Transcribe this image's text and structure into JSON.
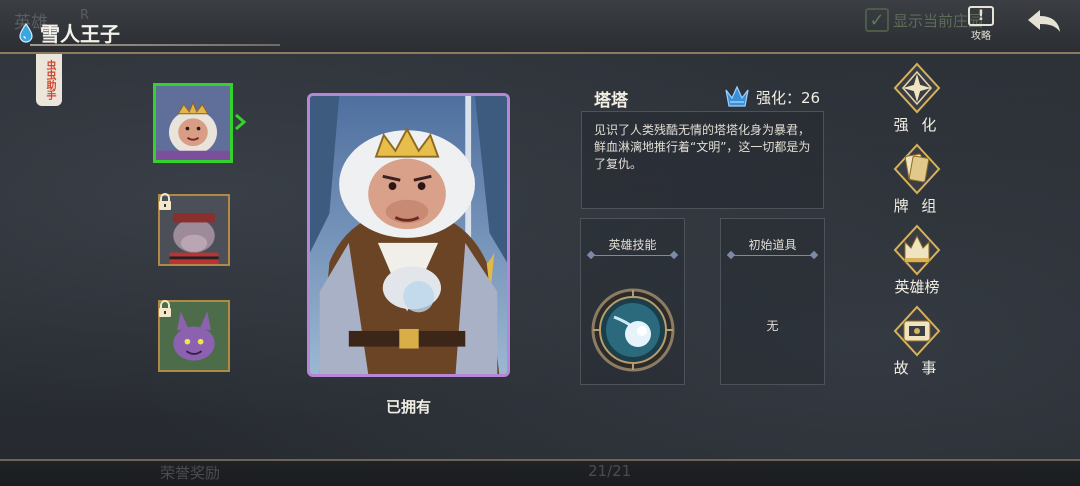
{
  "header": {
    "faded_tab_1": "英雄",
    "faded_tab_2": "R",
    "title": "雪人王子",
    "show_current_label": "显示当前庄园",
    "guide_label": "攻略"
  },
  "helper_tab": "虫虫助手",
  "hero_list": [
    {
      "name": "snowman-prince",
      "locked": false,
      "selected": true
    },
    {
      "name": "hippo-pirate",
      "locked": true,
      "selected": false
    },
    {
      "name": "purple-creature",
      "locked": true,
      "selected": false
    }
  ],
  "portrait": {
    "status_label": "已拥有"
  },
  "hero_info": {
    "name": "塔塔",
    "enhance_label": "强化：26",
    "lore": "见识了人类残酷无情的塔塔化身为暴君，鲜血淋漓地推行着“文明”，这一切都是为了复仇。"
  },
  "skill_panel": {
    "title": "英雄技能",
    "icon": "ice-comet-skill-icon"
  },
  "item_panel": {
    "title": "初始道具",
    "value": "无"
  },
  "side_menu": [
    {
      "label": "强 化",
      "icon": "enhance-compass-icon"
    },
    {
      "label": "牌 组",
      "icon": "deck-cards-icon"
    },
    {
      "label": "英雄榜",
      "icon": "hero-rank-icon"
    },
    {
      "label": "故 事",
      "icon": "story-scroll-icon"
    }
  ],
  "footer": {
    "faded_reward_label": "荣誉奖励",
    "faded_page_count": "21/21"
  },
  "colors": {
    "selected_border": "#35d12c",
    "locked_border": "#b08a44",
    "portrait_border": "#b587d6",
    "accent_gold": "#d8b25a"
  }
}
